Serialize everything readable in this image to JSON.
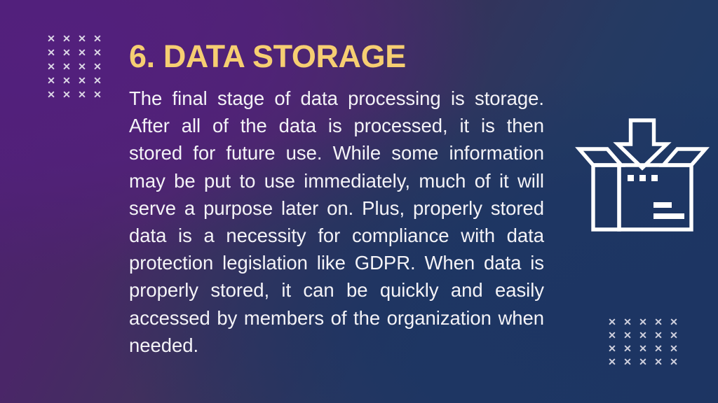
{
  "slide": {
    "title": "6. DATA STORAGE",
    "body": "The final stage of data processing is storage. After all of the data is processed, it is then stored for future use. While some information may be put to use immediately, much of it will serve a purpose later on. Plus, properly stored data is a necessity for compliance with data protection legislation like GDPR. When data is properly stored, it can be quickly and easily accessed by members of the organization when needed."
  },
  "decorations": {
    "top_left_grid": {
      "icon": "x-mark-grid",
      "columns": 4,
      "rows": 5,
      "color": "#e8e6f0"
    },
    "bottom_right_grid": {
      "icon": "x-mark-grid",
      "columns": 5,
      "rows": 4,
      "color": "#e8e6f0"
    },
    "storage_icon": {
      "icon": "open-box-with-down-arrow-icon",
      "color": "#ffffff"
    }
  },
  "colors": {
    "title": "#f6ce72",
    "body_text": "#f4f3f7",
    "background_purple": "#4d2171",
    "background_navy": "#1c3360",
    "icon_stroke": "#ffffff"
  }
}
